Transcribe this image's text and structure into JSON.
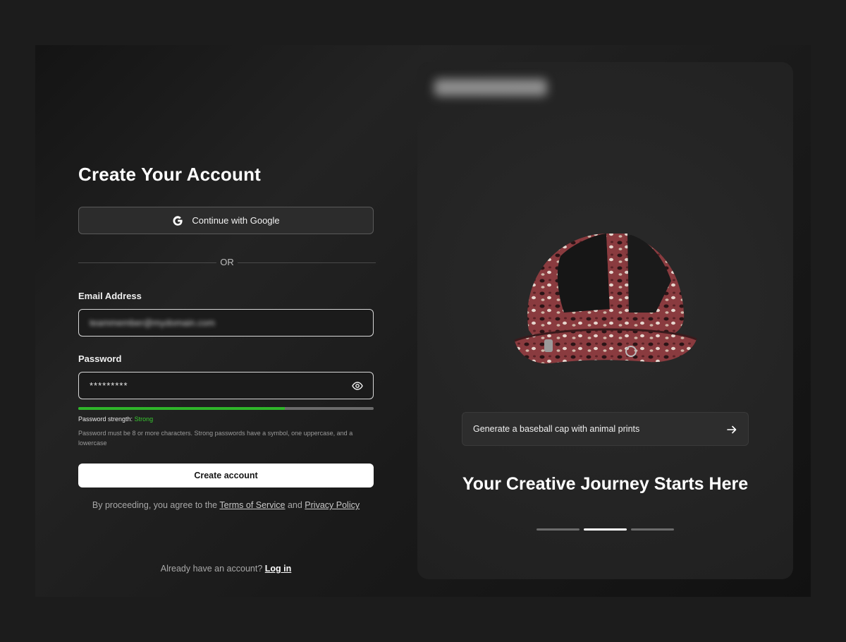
{
  "signup": {
    "title": "Create Your Account",
    "google_label": "Continue with Google",
    "or_label": "OR",
    "email_label": "Email Address",
    "email_value": "teammember@mydomain.com",
    "password_label": "Password",
    "password_value": "*********",
    "strength_prefix": "Password strength:",
    "strength_value": "Strong",
    "strength_fraction": 0.7,
    "hint": "Password must be 8 or more characters. Strong passwords have a symbol, one uppercase, and a lowercase",
    "create_label": "Create account",
    "terms_prefix": "By proceeding, you agree to the",
    "terms_link": "Terms of Service",
    "terms_and": "and",
    "privacy_link": "Privacy Policy",
    "already_text": "Already have an account?",
    "login_link": "Log in"
  },
  "showcase": {
    "prompt": "Generate a baseball cap with animal prints",
    "tagline": "Your Creative Journey Starts Here",
    "slides": 3,
    "active_slide": 2
  },
  "colors": {
    "accent_green": "#2fb62a",
    "background": "#1c1c1c",
    "panel": "#262626"
  },
  "icons": [
    "google-icon",
    "eye-icon",
    "arrow-right-icon"
  ]
}
